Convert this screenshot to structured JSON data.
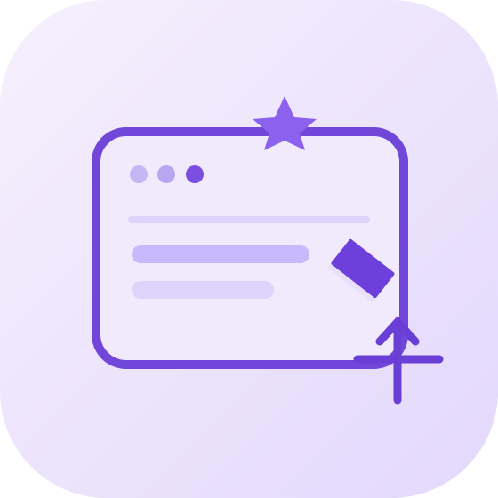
{
  "icon": {
    "name": "browser-window-with-star-pencil-and-cursor",
    "background_gradient": [
      "#f4eefc",
      "#e6dbfb"
    ],
    "accent_color": "#7a4fe0",
    "accent_dark": "#6a3fd6",
    "star_color": "#8a60ec",
    "window_fill": "#f1eafd",
    "dots": [
      "#c2b3f3",
      "#b7a3f2",
      "#7a4fe0"
    ],
    "text_lines": [
      "#d6ccfb",
      "#c5b7fa",
      "#dcd3fc"
    ]
  }
}
